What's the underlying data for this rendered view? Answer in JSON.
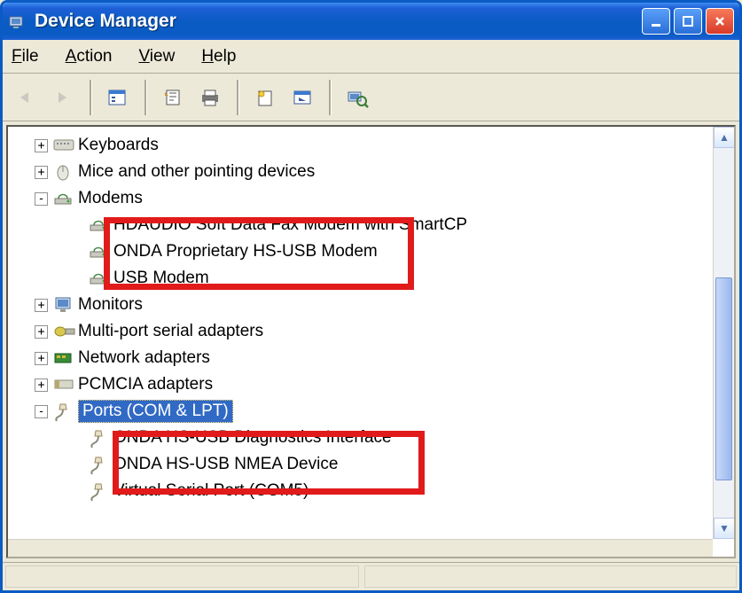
{
  "window": {
    "title": "Device Manager"
  },
  "menu": {
    "file": "File",
    "action": "Action",
    "view": "View",
    "help": "Help"
  },
  "tree": {
    "items": [
      {
        "label": "Keyboards",
        "expand": "+",
        "indent": 0,
        "hasExp": true,
        "type": "keyboard"
      },
      {
        "label": "Mice and other pointing devices",
        "expand": "+",
        "indent": 0,
        "hasExp": true,
        "type": "mouse"
      },
      {
        "label": "Modems",
        "expand": "-",
        "indent": 0,
        "hasExp": true,
        "type": "modem"
      },
      {
        "label": "HDAUDIO Soft Data Fax Modem with SmartCP",
        "indent": 1,
        "hasExp": false,
        "type": "modem"
      },
      {
        "label": "ONDA Proprietary HS-USB Modem",
        "indent": 1,
        "hasExp": false,
        "type": "modem"
      },
      {
        "label": "USB Modem",
        "indent": 1,
        "hasExp": false,
        "type": "modem"
      },
      {
        "label": "Monitors",
        "expand": "+",
        "indent": 0,
        "hasExp": true,
        "type": "monitor"
      },
      {
        "label": "Multi-port serial adapters",
        "expand": "+",
        "indent": 0,
        "hasExp": true,
        "type": "multiport"
      },
      {
        "label": "Network adapters",
        "expand": "+",
        "indent": 0,
        "hasExp": true,
        "type": "network"
      },
      {
        "label": "PCMCIA adapters",
        "expand": "+",
        "indent": 0,
        "hasExp": true,
        "type": "pcmcia"
      },
      {
        "label": "Ports (COM & LPT)",
        "expand": "-",
        "indent": 0,
        "hasExp": true,
        "type": "port",
        "selected": true
      },
      {
        "label": "ONDA HS-USB Diagnostics Interface",
        "indent": 1,
        "hasExp": false,
        "type": "port"
      },
      {
        "label": "ONDA HS-USB NMEA Device",
        "indent": 1,
        "hasExp": false,
        "type": "port"
      },
      {
        "label": "Virtual Serial Port (COM5)",
        "indent": 1,
        "hasExp": false,
        "type": "port"
      }
    ]
  }
}
